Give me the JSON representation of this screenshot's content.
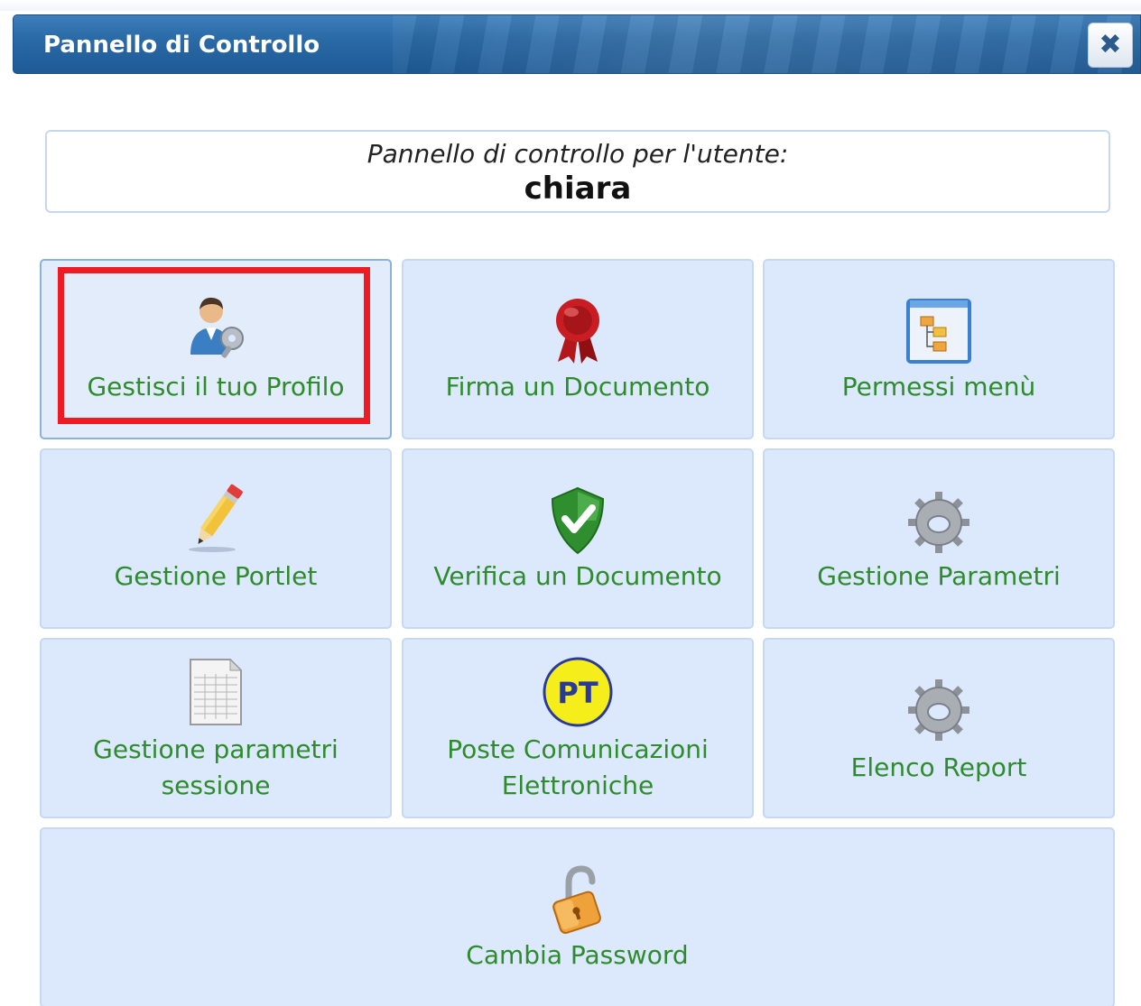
{
  "window": {
    "title": "Pannello di Controllo",
    "close_label": "✖"
  },
  "user_box": {
    "caption": "Pannello di controllo per l'utente:",
    "username": "chiara"
  },
  "tiles": [
    {
      "label": "Gestisci il tuo Profilo",
      "icon": "user-profile-icon"
    },
    {
      "label": "Firma un Documento",
      "icon": "ribbon-seal-icon"
    },
    {
      "label": "Permessi menù",
      "icon": "menu-tree-window-icon"
    },
    {
      "label": "Gestione Portlet",
      "icon": "pencil-icon"
    },
    {
      "label": "Verifica un Documento",
      "icon": "shield-check-icon"
    },
    {
      "label": "Gestione Parametri",
      "icon": "gear-icon"
    },
    {
      "label": "Gestione parametri",
      "label2": "sessione",
      "icon": "spreadsheet-icon"
    },
    {
      "label": "Poste Comunicazioni",
      "label2": "Elettroniche",
      "icon": "pt-logo-icon",
      "logo_text": "PT"
    },
    {
      "label": "Elenco Report",
      "icon": "gear-icon"
    },
    {
      "label": "Cambia Password",
      "icon": "open-padlock-icon"
    }
  ],
  "colors": {
    "titlebar": "#2a6aa6",
    "tile_background": "#dce8fc",
    "tile_label": "#2e8b2e",
    "highlight": "#ee1b24"
  }
}
